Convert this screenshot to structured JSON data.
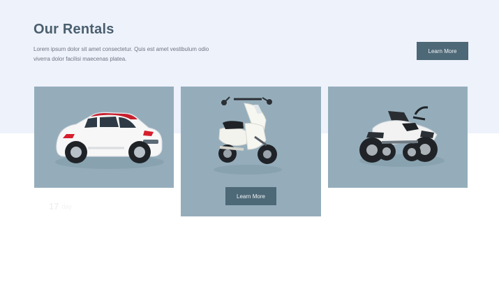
{
  "section": {
    "title": "Our Rentals",
    "description": "Lorem ipsum dolor sit amet consectetur. Quis est amet vestibulum odio viverra dolor facilisi maecenas platea.",
    "button_label": "Learn More"
  },
  "cards": [
    {
      "vehicle": "car",
      "icon": "car-image"
    },
    {
      "vehicle": "scooter",
      "icon": "scooter-image",
      "button_label": "Learn More"
    },
    {
      "vehicle": "atv",
      "icon": "atv-image"
    }
  ],
  "faint_note": {
    "number": "17",
    "text": "day"
  },
  "colors": {
    "hero_background": "#eef2fb",
    "card_background": "#95adbb",
    "button_background": "#4d6877",
    "title_color": "#4a5f6e"
  }
}
